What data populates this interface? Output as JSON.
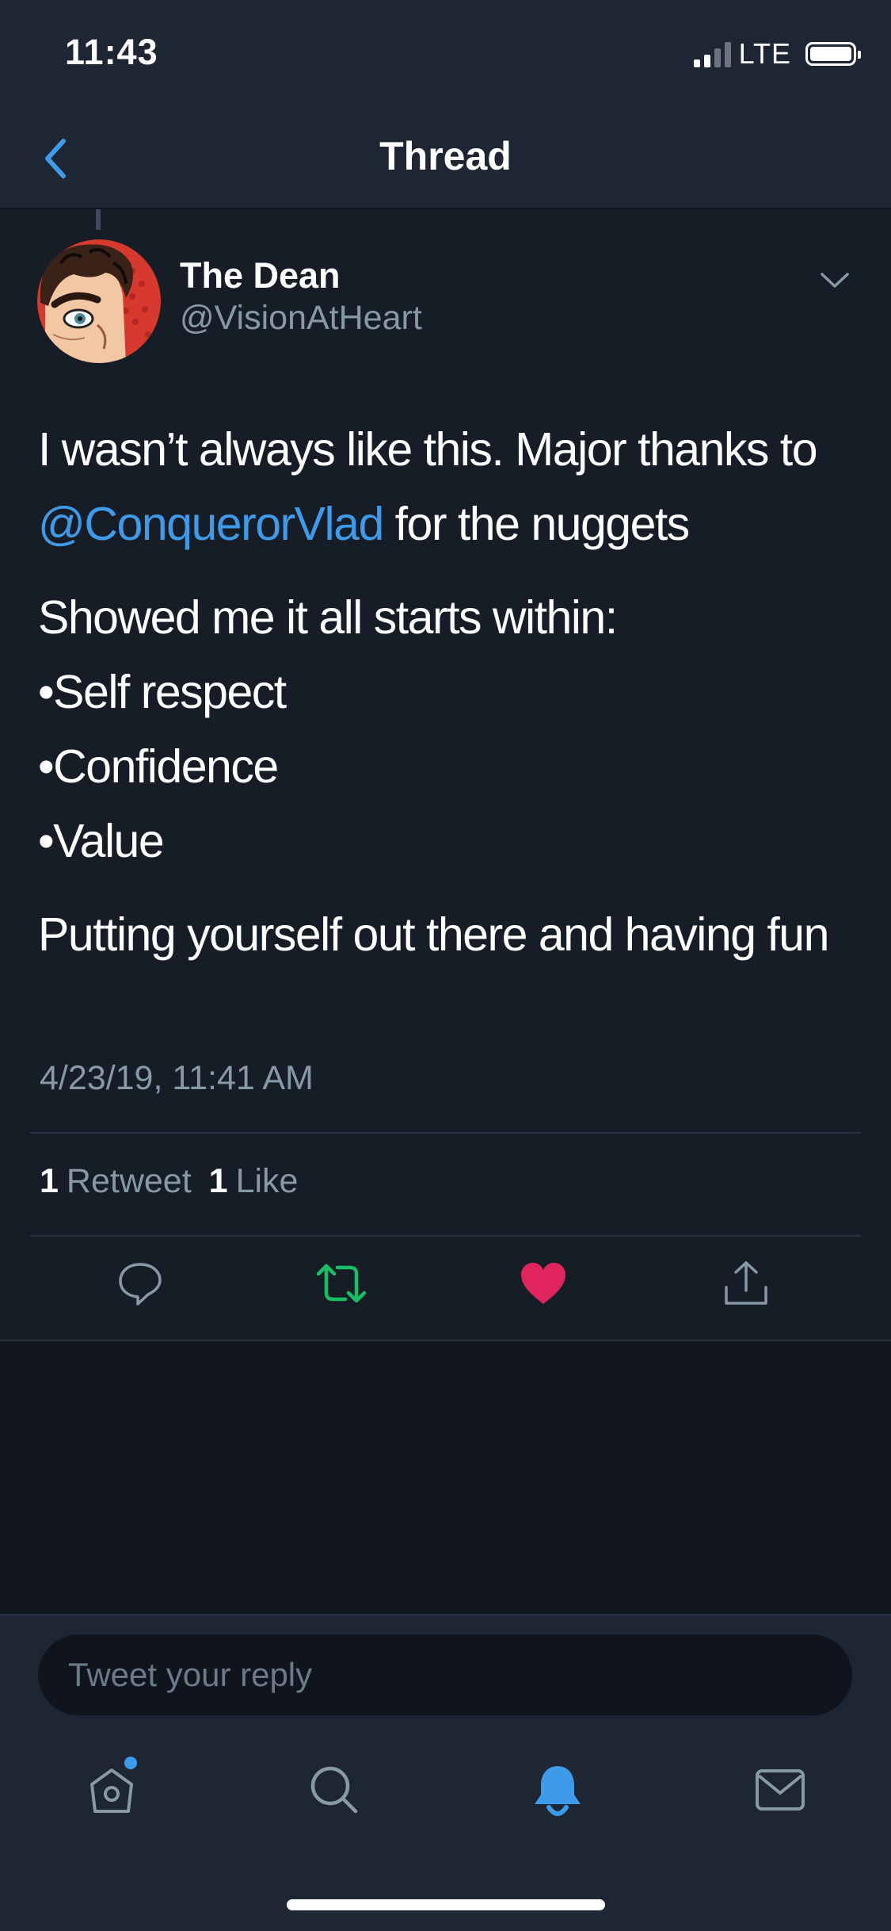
{
  "status_bar": {
    "time": "11:43",
    "network": "LTE"
  },
  "nav": {
    "title": "Thread"
  },
  "tweet": {
    "author_name": "The Dean",
    "author_handle": "@VisionAtHeart",
    "text": {
      "line1_a": "I wasn’t always like this. Major thanks to ",
      "mention": "@ConquerorVlad",
      "line1_b": " for the nuggets",
      "intro": "Showed me it all starts within:",
      "bullets": [
        "•Self respect",
        "•Confidence",
        "•Value"
      ],
      "closing": "Putting yourself out there and having fun"
    },
    "timestamp": "4/23/19, 11:41 AM",
    "stats": {
      "retweet_count": "1",
      "retweet_label": "Retweet",
      "like_count": "1",
      "like_label": "Like"
    },
    "actions": [
      "reply-icon",
      "retweet-icon",
      "like-icon",
      "share-icon"
    ]
  },
  "reply": {
    "placeholder": "Tweet your reply"
  },
  "tab_bar": {
    "tabs": [
      "home-icon",
      "search-icon",
      "notifications-icon",
      "messages-icon"
    ],
    "active": "notifications-icon"
  },
  "colors": {
    "accent": "#3d9bea",
    "retweet_active": "#17bf63",
    "like_active": "#e0245e",
    "background": "#161d27",
    "bar": "#1e2634",
    "secondary_text": "#8899a6"
  }
}
